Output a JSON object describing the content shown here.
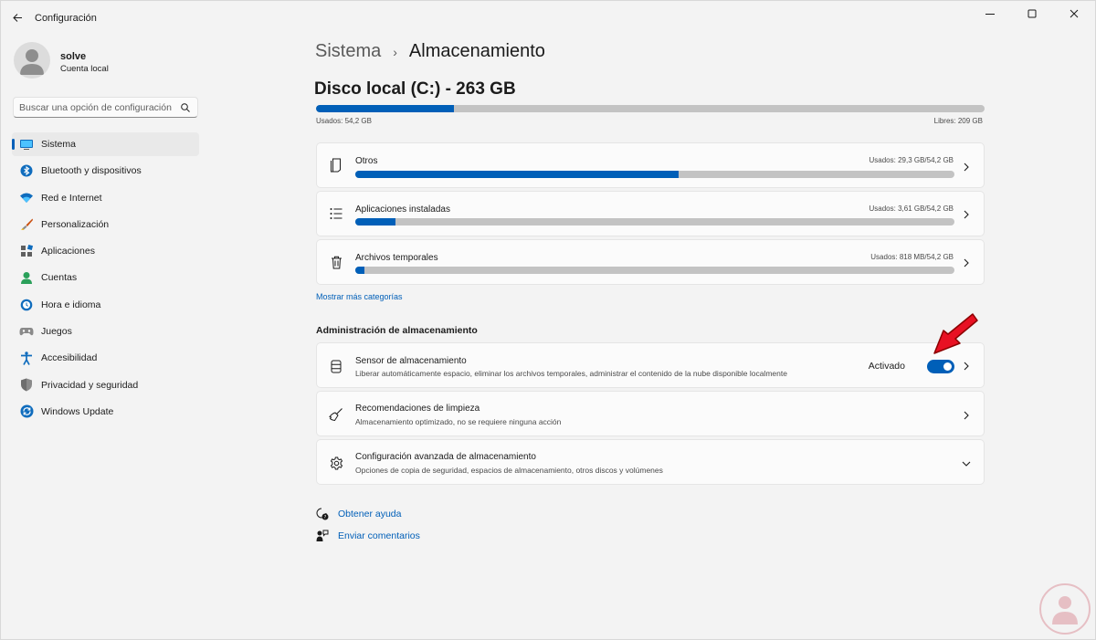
{
  "window": {
    "title": "Configuración",
    "controls": [
      "minimize-icon",
      "maximize-icon",
      "close-icon"
    ]
  },
  "user": {
    "name": "solve",
    "account_type": "Cuenta local"
  },
  "search": {
    "placeholder": "Buscar una opción de configuración"
  },
  "sidebar": {
    "items": [
      {
        "label": "Sistema",
        "icon": "system-icon",
        "active": true
      },
      {
        "label": "Bluetooth y dispositivos",
        "icon": "bluetooth-icon"
      },
      {
        "label": "Red e Internet",
        "icon": "wifi-icon"
      },
      {
        "label": "Personalización",
        "icon": "brush-icon"
      },
      {
        "label": "Aplicaciones",
        "icon": "apps-icon"
      },
      {
        "label": "Cuentas",
        "icon": "accounts-icon"
      },
      {
        "label": "Hora e idioma",
        "icon": "time-language-icon"
      },
      {
        "label": "Juegos",
        "icon": "gamepad-icon"
      },
      {
        "label": "Accesibilidad",
        "icon": "accessibility-icon"
      },
      {
        "label": "Privacidad y seguridad",
        "icon": "shield-icon"
      },
      {
        "label": "Windows Update",
        "icon": "windows-update-icon"
      }
    ]
  },
  "breadcrumb": {
    "parent": "Sistema",
    "separator": "›",
    "current": "Almacenamiento"
  },
  "disk": {
    "title": "Disco local (C:) - 263 GB",
    "used_label": "Usados: 54,2 GB",
    "free_label": "Libres: 209 GB",
    "used_fraction": 0.206
  },
  "categories": [
    {
      "label": "Otros",
      "usage": "Usados: 29,3 GB/54,2 GB",
      "fraction": 0.54,
      "icon": "document-icon"
    },
    {
      "label": "Aplicaciones instaladas",
      "usage": "Usados: 3,61 GB/54,2 GB",
      "fraction": 0.067,
      "icon": "list-icon"
    },
    {
      "label": "Archivos temporales",
      "usage": "Usados: 818 MB/54,2 GB",
      "fraction": 0.015,
      "icon": "trash-icon"
    }
  ],
  "show_more": "Mostrar más categorías",
  "management": {
    "heading": "Administración de almacenamiento",
    "items": [
      {
        "title": "Sensor de almacenamiento",
        "description": "Liberar automáticamente espacio, eliminar los archivos temporales, administrar el contenido de la nube disponible localmente",
        "toggle_state": "Activado",
        "toggle_on": true,
        "icon": "storage-drive-icon"
      },
      {
        "title": "Recomendaciones de limpieza",
        "description": "Almacenamiento optimizado, no se requiere ninguna acción",
        "icon": "broom-icon"
      },
      {
        "title": "Configuración avanzada de almacenamiento",
        "description": "Opciones de copia de seguridad, espacios de almacenamiento, otros discos y volúmenes",
        "icon": "gear-icon"
      }
    ]
  },
  "help_links": [
    {
      "label": "Obtener ayuda",
      "icon": "help-icon"
    },
    {
      "label": "Enviar comentarios",
      "icon": "feedback-icon"
    }
  ],
  "colors": {
    "accent": "#005fb8",
    "bar_background": "#c3c3c3",
    "annotation_arrow": "#e81123"
  }
}
